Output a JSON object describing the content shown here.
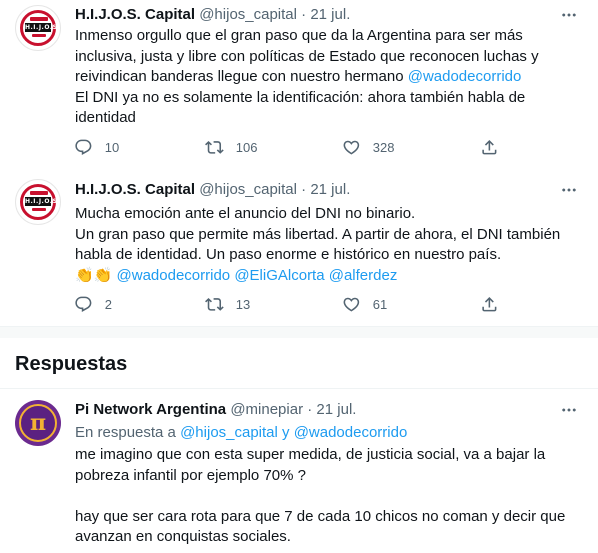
{
  "tweets": [
    {
      "name": "H.I.J.O.S. Capital",
      "handle": "@hijos_capital",
      "dot": "·",
      "date": "21 jul.",
      "lines": [
        "Inmenso orgullo que el gran paso que da la Argentina para ser más",
        "inclusiva, justa y libre con políticas de Estado que reconocen luchas y",
        "reivindican banderas llegue con nuestro hermano ",
        "El DNI ya no es solamente la identificación: ahora también habla de",
        "identidad"
      ],
      "mention": "@wadodecorrido",
      "replies": "10",
      "retweets": "106",
      "likes": "328"
    },
    {
      "name": "H.I.J.O.S. Capital",
      "handle": "@hijos_capital",
      "dot": "·",
      "date": "21 jul.",
      "lines": [
        "Mucha emoción ante el anuncio del DNI no binario.",
        "Un gran paso que permite más libertad. A partir de ahora, el DNI también",
        "habla de identidad. Un paso enorme e histórico en nuestro país."
      ],
      "emoji_line": {
        "emoji": "👏👏",
        "mentions": "@wadodecorrido @EliGAlcorta @alferdez"
      },
      "replies": "2",
      "retweets": "13",
      "likes": "61"
    }
  ],
  "section": {
    "title": "Respuestas"
  },
  "reply": {
    "name": "Pi Network Argentina",
    "handle": "@minepiar",
    "dot": "·",
    "date": "21 jul.",
    "reply_prefix": "En respuesta a ",
    "reply_targets": "@hijos_capital y @wadodecorrido",
    "lines": [
      "me imagino que con esta super medida, de justicia social, va a bajar la",
      "pobreza infantil por ejemplo 70% ?",
      "",
      "hay que ser cara rota para que 7 de cada 10 chicos no coman y decir que",
      "avanzan en conquistas sociales."
    ]
  },
  "avatars": {
    "hijos_text": "H.I.J.O.S",
    "pi_symbol": "π"
  },
  "colors": {
    "link": "#1d9bf0",
    "muted": "#536471",
    "text": "#0f1419",
    "brand_red": "#c8102e",
    "pi_purple": "#5b2181",
    "pi_gold": "#f2b233"
  },
  "icons": [
    "reply-icon",
    "retweet-icon",
    "like-icon",
    "share-icon",
    "more-icon",
    "clap-emoji"
  ]
}
